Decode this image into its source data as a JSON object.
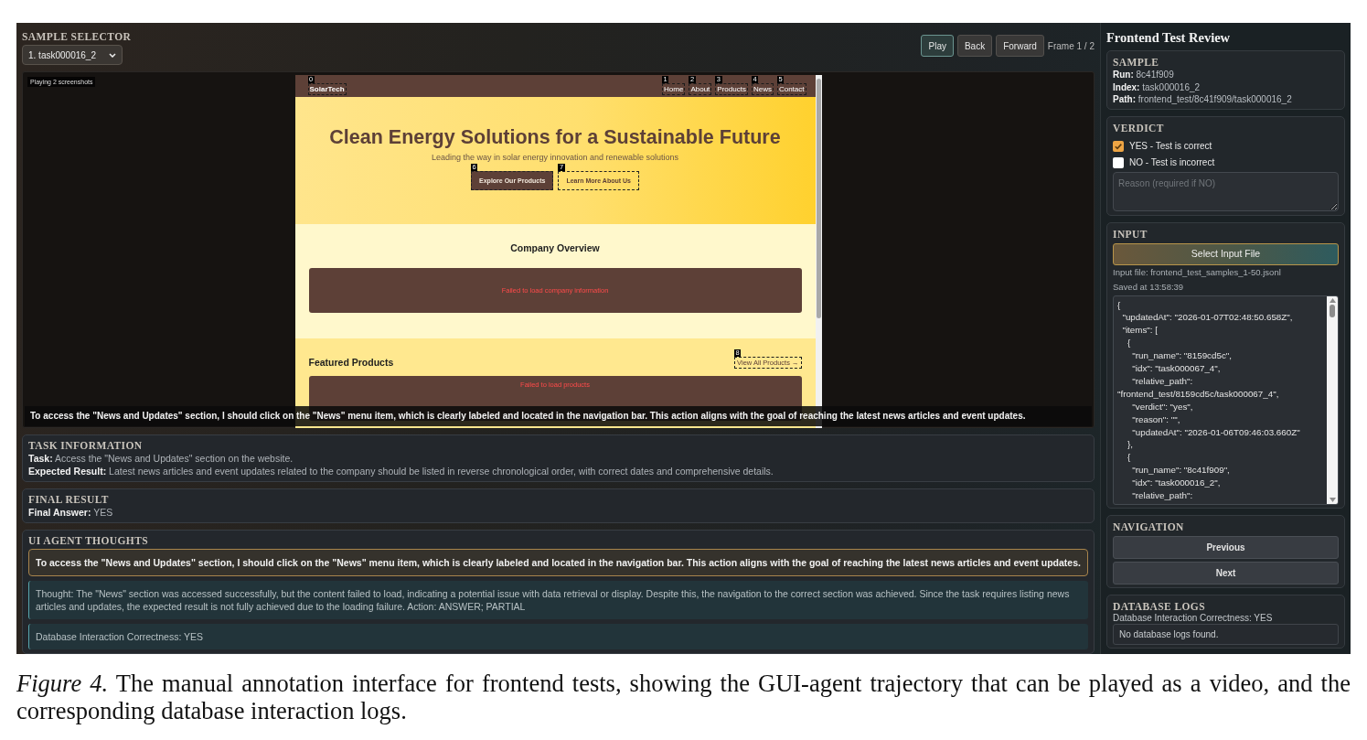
{
  "sample_selector": {
    "title": "SAMPLE SELECTOR",
    "value": "1. task000016_2"
  },
  "player": {
    "buttons": [
      {
        "label": "Play",
        "kind": "primary"
      },
      {
        "label": "Back",
        "kind": "secondary"
      },
      {
        "label": "Forward",
        "kind": "secondary"
      }
    ],
    "frame_label": "Frame 1 / 2"
  },
  "viewer": {
    "status": "Playing 2 screenshots",
    "screenshot": {
      "brand": {
        "label": "SolarTech",
        "marker": "0"
      },
      "nav": [
        {
          "label": "Home",
          "marker": "1"
        },
        {
          "label": "About",
          "marker": "2"
        },
        {
          "label": "Products",
          "marker": "3"
        },
        {
          "label": "News",
          "marker": "4"
        },
        {
          "label": "Contact",
          "marker": "5"
        }
      ],
      "hero": {
        "title": "Clean Energy Solutions for a Sustainable Future",
        "subtitle": "Leading the way in solar energy innovation and renewable solutions",
        "buttons": [
          {
            "label": "Explore Our Products",
            "marker": "6",
            "kind": "filled"
          },
          {
            "label": "Learn More About Us",
            "marker": "7",
            "kind": "outline"
          }
        ]
      },
      "sections": [
        {
          "title": "Company Overview",
          "error": "Failed to load company information"
        },
        {
          "title": "Featured Products",
          "link": {
            "label": "View All Products →",
            "marker": "8"
          },
          "error": "Failed to load products"
        }
      ]
    },
    "overlay_text": "To access the \"News and Updates\" section, I should click on the \"News\" menu item, which is clearly labeled and located in the navigation bar. This action aligns with the goal of reaching the latest news articles and event updates."
  },
  "task_information": {
    "title": "TASK INFORMATION",
    "lines": [
      "**Task:** Access the \"News and Updates\" section on the website.",
      "**Expected Result:** Latest news articles and event updates related to the company should be listed in reverse chronological order, with correct dates and comprehensive details."
    ]
  },
  "final_result": {
    "title": "FINAL RESULT",
    "lines": [
      "**Final Answer:** YES"
    ]
  },
  "agent_thoughts": {
    "title": "UI AGENT THOUGHTS",
    "entries": [
      {
        "kind": "action",
        "text": "To access the \"News and Updates\" section, I should click on the \"News\" menu item, which is clearly labeled and located in the navigation bar. This action aligns with the goal of reaching the latest news articles and event updates."
      },
      {
        "kind": "thought",
        "text": "Thought: The \"News\" section was accessed successfully, but the content failed to load, indicating a potential issue with data retrieval or display. Despite this, the navigation to the correct section was achieved. Since the task requires listing news articles and updates, the expected result is not fully achieved due to the loading failure. Action: ANSWER; PARTIAL"
      },
      {
        "kind": "thought",
        "text": "Database Interaction Correctness: YES"
      }
    ]
  },
  "review": {
    "title": "Frontend Test Review",
    "sample": {
      "title": "SAMPLE",
      "lines": [
        "**Run:** 8c41f909",
        "**Index:** task000016_2",
        "**Path:** frontend_test/8c41f909/task000016_2"
      ]
    },
    "verdict": {
      "title": "VERDICT",
      "options": [
        {
          "label": "YES - Test is correct",
          "checked": true
        },
        {
          "label": "NO - Test is incorrect",
          "checked": false
        }
      ],
      "reason": {
        "placeholder": "Reason (required if NO)"
      }
    },
    "input": {
      "title": "INPUT",
      "button": "Select Input File",
      "file_info": "Input file: frontend_test_samples_1-50.jsonl",
      "saved": "Saved at 13:58:39",
      "json_lines": [
        "{",
        "  \"updatedAt\": \"2026-01-07T02:48:50.658Z\",",
        "  \"items\": [",
        "    {",
        "      \"run_name\": \"8159cd5c\",",
        "      \"idx\": \"task000067_4\",",
        "      \"relative_path\":",
        "\"frontend_test/8159cd5c/task000067_4\",",
        "      \"verdict\": \"yes\",",
        "      \"reason\": \"\",",
        "      \"updatedAt\": \"2026-01-06T09:46:03.660Z\"",
        "    },",
        "    {",
        "      \"run_name\": \"8c41f909\",",
        "      \"idx\": \"task000016_2\",",
        "      \"relative_path\":"
      ]
    },
    "navigation": {
      "title": "NAVIGATION",
      "buttons": [
        "Previous",
        "Next"
      ]
    },
    "database_logs": {
      "title": "DATABASE LOGS",
      "summary": "Database Interaction Correctness: YES",
      "log": "No database logs found."
    }
  },
  "caption": "*Figure 4.* The manual annotation interface for frontend tests, showing the GUI-agent trajectory that can be played as a video, and the corresponding database interaction logs."
}
